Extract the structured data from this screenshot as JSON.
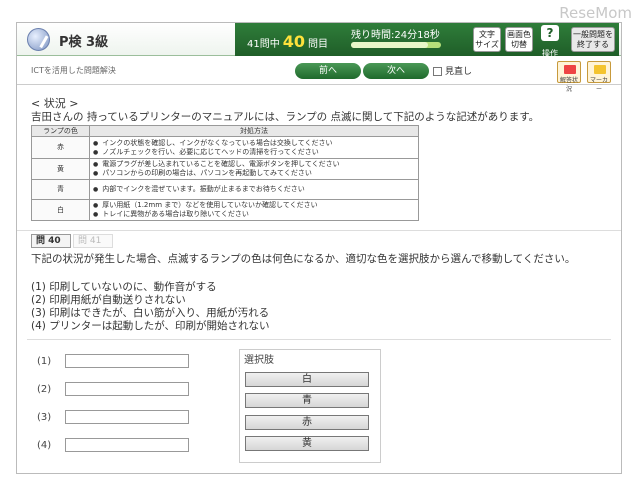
{
  "watermark": "ReseMom",
  "header": {
    "exam_title": "P検 3級",
    "total_prefix": "41問中",
    "current_question": "40",
    "question_suffix": "問目",
    "timer": "残り時間:24分18秒",
    "time_remaining_fraction": 0.85,
    "buttons": {
      "text_size": "文字\nサイズ",
      "screen_color": "画面色\n切替",
      "help_icon": "?",
      "help": "操作",
      "general": "一般問題を\n終了する"
    }
  },
  "subbar": {
    "section": "ICTを活用した問題解決",
    "prev": "前へ",
    "next": "次へ",
    "review": "見直し",
    "tool_status": "解答状況",
    "tool_marker": "マーカー"
  },
  "context": {
    "heading": "< 状況 >",
    "body": "吉田さんの 持っているプリンターのマニュアルには、ランプの 点滅に関して下記のような記述があります。"
  },
  "lamp_table": {
    "headers": [
      "ランプの色",
      "対処方法"
    ],
    "rows": [
      {
        "color": "赤",
        "lines": [
          "インクの状態を確認し、インクがなくなっている場合は交換してください",
          "ノズルチェックを行い、必要に応じてヘッドの清掃を行ってください"
        ]
      },
      {
        "color": "黄",
        "lines": [
          "電源プラグが差し込まれていることを確認し、電源ボタンを押してください",
          "パソコンからの印刷の場合は、パソコンを再起動してみてください"
        ]
      },
      {
        "color": "青",
        "lines": [
          "内部でインクを混ぜています。振動が止まるまでお待ちください"
        ]
      },
      {
        "color": "白",
        "lines": [
          "厚い用紙（1.2mm まで）などを使用していないか確認してください",
          "トレイに異物がある場合は取り除いてください"
        ]
      }
    ]
  },
  "tabs": [
    "問 40",
    "問 41"
  ],
  "question": {
    "text": "下記の状況が発生した場合、点滅するランプの色は何色になるか、適切な色を選択肢から選んで移動してください。",
    "items": [
      "(1) 印刷していないのに、動作音がする",
      "(2) 印刷用紙が自動送りされない",
      "(3) 印刷はできたが、白い筋が入り、用紙が汚れる",
      "(4) プリンターは起動したが、印刷が開始されない"
    ]
  },
  "answers": {
    "labels": [
      "(1)",
      "(2)",
      "(3)",
      "(4)"
    ]
  },
  "choices": {
    "title": "選択肢",
    "options": [
      "白",
      "青",
      "赤",
      "黄"
    ]
  }
}
